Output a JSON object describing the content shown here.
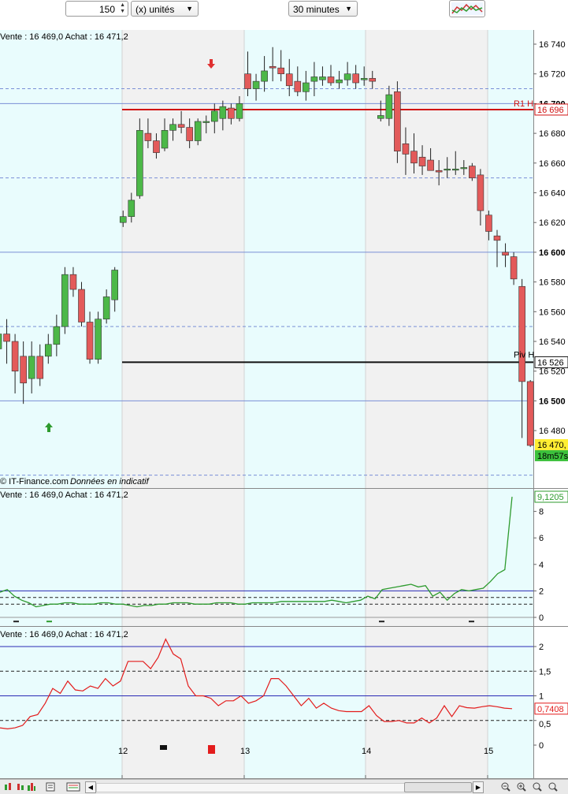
{
  "toolbar": {
    "quantity": "150",
    "unit_label": "(x) unités",
    "timeframe": "30 minutes"
  },
  "price_chart": {
    "header": "Vente : 16 469,0 Achat : 16 471,2",
    "watermark_source": "© IT-Finance.com",
    "watermark_note": "Données en indicatif",
    "y_ticks": [
      {
        "label": "16 740",
        "v": 16740,
        "bold": false
      },
      {
        "label": "16 720",
        "v": 16720,
        "bold": false
      },
      {
        "label": "16 700",
        "v": 16700,
        "bold": true
      },
      {
        "label": "16 680",
        "v": 16680,
        "bold": false
      },
      {
        "label": "16 660",
        "v": 16660,
        "bold": false
      },
      {
        "label": "16 640",
        "v": 16640,
        "bold": false
      },
      {
        "label": "16 620",
        "v": 16620,
        "bold": false
      },
      {
        "label": "16 600",
        "v": 16600,
        "bold": true
      },
      {
        "label": "16 580",
        "v": 16580,
        "bold": false
      },
      {
        "label": "16 560",
        "v": 16560,
        "bold": false
      },
      {
        "label": "16 540",
        "v": 16540,
        "bold": false
      },
      {
        "label": "16 520",
        "v": 16520,
        "bold": false
      },
      {
        "label": "16 500",
        "v": 16500,
        "bold": true
      },
      {
        "label": "16 480",
        "v": 16480,
        "bold": false
      }
    ],
    "r1_label": "R1 H",
    "r1_price": "16 696",
    "piv_label": "Piv H",
    "piv_price": "16 526",
    "last_price": "16 470,",
    "countdown": "18m57s",
    "x_labels": [
      "12",
      "13",
      "14",
      "15"
    ]
  },
  "indicator1": {
    "header": "Vente : 16 469,0 Achat : 16 471,2",
    "value": "9,1205",
    "ticks": [
      "8",
      "6",
      "4",
      "2",
      "0"
    ]
  },
  "indicator2": {
    "header": "Vente : 16 469,0 Achat : 16 471,2",
    "value": "0,7408",
    "ticks": [
      "2",
      "1,5",
      "1",
      "0,5",
      "0"
    ]
  },
  "chart_data": [
    {
      "type": "candlestick",
      "title": "",
      "timeframe": "30 minutes",
      "x_ticks": [
        "12",
        "13",
        "14",
        "15"
      ],
      "ylim": [
        16450,
        16755
      ],
      "levels": {
        "R1 H": 16696,
        "Piv H": 16526
      },
      "last": 16470,
      "candles": [
        {
          "o": 16535,
          "h": 16550,
          "l": 16515,
          "c": 16545
        },
        {
          "o": 16545,
          "h": 16555,
          "l": 16525,
          "c": 16540
        },
        {
          "o": 16540,
          "h": 16545,
          "l": 16505,
          "c": 16520
        },
        {
          "o": 16530,
          "h": 16540,
          "l": 16498,
          "c": 16512
        },
        {
          "o": 16515,
          "h": 16540,
          "l": 16505,
          "c": 16530
        },
        {
          "o": 16530,
          "h": 16538,
          "l": 16510,
          "c": 16515
        },
        {
          "o": 16530,
          "h": 16545,
          "l": 16525,
          "c": 16538
        },
        {
          "o": 16538,
          "h": 16558,
          "l": 16530,
          "c": 16550
        },
        {
          "o": 16550,
          "h": 16590,
          "l": 16545,
          "c": 16585
        },
        {
          "o": 16585,
          "h": 16590,
          "l": 16570,
          "c": 16575
        },
        {
          "o": 16575,
          "h": 16580,
          "l": 16550,
          "c": 16553
        },
        {
          "o": 16553,
          "h": 16560,
          "l": 16525,
          "c": 16528
        },
        {
          "o": 16528,
          "h": 16560,
          "l": 16525,
          "c": 16555
        },
        {
          "o": 16555,
          "h": 16575,
          "l": 16552,
          "c": 16570
        },
        {
          "o": 16568,
          "h": 16590,
          "l": 16560,
          "c": 16588
        },
        {
          "o": 16620,
          "h": 16628,
          "l": 16617,
          "c": 16624
        },
        {
          "o": 16624,
          "h": 16640,
          "l": 16620,
          "c": 16635
        },
        {
          "o": 16638,
          "h": 16690,
          "l": 16636,
          "c": 16682
        },
        {
          "o": 16680,
          "h": 16690,
          "l": 16670,
          "c": 16675
        },
        {
          "o": 16675,
          "h": 16680,
          "l": 16663,
          "c": 16667
        },
        {
          "o": 16670,
          "h": 16690,
          "l": 16668,
          "c": 16682
        },
        {
          "o": 16682,
          "h": 16690,
          "l": 16675,
          "c": 16686
        },
        {
          "o": 16686,
          "h": 16695,
          "l": 16680,
          "c": 16684
        },
        {
          "o": 16684,
          "h": 16690,
          "l": 16670,
          "c": 16675
        },
        {
          "o": 16675,
          "h": 16690,
          "l": 16672,
          "c": 16688
        },
        {
          "o": 16688,
          "h": 16692,
          "l": 16680,
          "c": 16688
        },
        {
          "o": 16688,
          "h": 16700,
          "l": 16680,
          "c": 16695
        },
        {
          "o": 16690,
          "h": 16702,
          "l": 16682,
          "c": 16698
        },
        {
          "o": 16697,
          "h": 16700,
          "l": 16686,
          "c": 16690
        },
        {
          "o": 16690,
          "h": 16705,
          "l": 16688,
          "c": 16700
        },
        {
          "o": 16720,
          "h": 16735,
          "l": 16705,
          "c": 16710
        },
        {
          "o": 16710,
          "h": 16720,
          "l": 16702,
          "c": 16715
        },
        {
          "o": 16715,
          "h": 16732,
          "l": 16708,
          "c": 16722
        },
        {
          "o": 16725,
          "h": 16738,
          "l": 16715,
          "c": 16724
        },
        {
          "o": 16724,
          "h": 16736,
          "l": 16715,
          "c": 16720
        },
        {
          "o": 16720,
          "h": 16730,
          "l": 16705,
          "c": 16712
        },
        {
          "o": 16715,
          "h": 16725,
          "l": 16705,
          "c": 16708
        },
        {
          "o": 16708,
          "h": 16722,
          "l": 16702,
          "c": 16714
        },
        {
          "o": 16715,
          "h": 16728,
          "l": 16705,
          "c": 16718
        },
        {
          "o": 16716,
          "h": 16725,
          "l": 16712,
          "c": 16718
        },
        {
          "o": 16718,
          "h": 16726,
          "l": 16712,
          "c": 16714
        },
        {
          "o": 16714,
          "h": 16722,
          "l": 16710,
          "c": 16716
        },
        {
          "o": 16716,
          "h": 16728,
          "l": 16712,
          "c": 16720
        },
        {
          "o": 16720,
          "h": 16726,
          "l": 16710,
          "c": 16714
        },
        {
          "o": 16716,
          "h": 16725,
          "l": 16712,
          "c": 16717
        },
        {
          "o": 16717,
          "h": 16722,
          "l": 16710,
          "c": 16715
        },
        {
          "o": 16690,
          "h": 16702,
          "l": 16688,
          "c": 16692
        },
        {
          "o": 16690,
          "h": 16712,
          "l": 16685,
          "c": 16706
        },
        {
          "o": 16708,
          "h": 16715,
          "l": 16660,
          "c": 16668
        },
        {
          "o": 16673,
          "h": 16684,
          "l": 16652,
          "c": 16666
        },
        {
          "o": 16668,
          "h": 16680,
          "l": 16653,
          "c": 16660
        },
        {
          "o": 16664,
          "h": 16672,
          "l": 16652,
          "c": 16658
        },
        {
          "o": 16662,
          "h": 16670,
          "l": 16655,
          "c": 16655
        },
        {
          "o": 16655,
          "h": 16662,
          "l": 16645,
          "c": 16654
        },
        {
          "o": 16656,
          "h": 16664,
          "l": 16650,
          "c": 16656
        },
        {
          "o": 16656,
          "h": 16668,
          "l": 16652,
          "c": 16656
        },
        {
          "o": 16657,
          "h": 16662,
          "l": 16652,
          "c": 16657
        },
        {
          "o": 16658,
          "h": 16660,
          "l": 16648,
          "c": 16650
        },
        {
          "o": 16652,
          "h": 16656,
          "l": 16618,
          "c": 16628
        },
        {
          "o": 16625,
          "h": 16628,
          "l": 16608,
          "c": 16614
        },
        {
          "o": 16611,
          "h": 16615,
          "l": 16590,
          "c": 16608
        },
        {
          "o": 16600,
          "h": 16606,
          "l": 16590,
          "c": 16598
        },
        {
          "o": 16597,
          "h": 16600,
          "l": 16578,
          "c": 16582
        },
        {
          "o": 16577,
          "h": 16582,
          "l": 16475,
          "c": 16513
        },
        {
          "o": 16513,
          "h": 16514,
          "l": 16469,
          "c": 16470
        }
      ]
    },
    {
      "type": "line",
      "title": "",
      "ylim": [
        -0.5,
        10
      ],
      "reference_lines": [
        2,
        1.5,
        1
      ],
      "series": [
        {
          "values": [
            1.9,
            2.1,
            1.6,
            1.3,
            1.1,
            0.8,
            0.9,
            1.0,
            1.0,
            1.1,
            1.1,
            1.0,
            1.0,
            1.0,
            1.1,
            1.1,
            1.0,
            1.0,
            0.9,
            0.8,
            0.9,
            0.9,
            1.0,
            1.0,
            1.1,
            1.1,
            1.1,
            1.0,
            1.0,
            1.0,
            1.1,
            1.1,
            1.1,
            1.0,
            1.0,
            1.1,
            1.1,
            1.1,
            1.1,
            1.2,
            1.2,
            1.2,
            1.2,
            1.2,
            1.2,
            1.2,
            1.3,
            1.2,
            1.1,
            1.2,
            1.3,
            1.6,
            1.4,
            2.1,
            2.2,
            2.3,
            2.4,
            2.5,
            2.3,
            2.4,
            1.6,
            1.9,
            1.3,
            1.8,
            2.1,
            2.0,
            2.1,
            2.2,
            2.7,
            3.3,
            3.6,
            9.1
          ]
        }
      ]
    },
    {
      "type": "line",
      "title": "",
      "ylim": [
        -0.2,
        2.4
      ],
      "reference_lines": [
        2,
        1.5,
        1,
        0.5
      ],
      "series": [
        {
          "values": [
            0.35,
            0.33,
            0.35,
            0.4,
            0.58,
            0.62,
            0.85,
            1.15,
            1.05,
            1.3,
            1.12,
            1.1,
            1.2,
            1.15,
            1.35,
            1.2,
            1.3,
            1.7,
            1.7,
            1.7,
            1.55,
            1.78,
            2.15,
            1.85,
            1.75,
            1.2,
            1.0,
            1.0,
            0.95,
            0.8,
            0.9,
            0.9,
            1.0,
            0.85,
            0.9,
            1.0,
            1.35,
            1.35,
            1.2,
            1.0,
            0.8,
            0.95,
            0.75,
            0.85,
            0.75,
            0.7,
            0.68,
            0.68,
            0.68,
            0.8,
            0.6,
            0.48,
            0.48,
            0.5,
            0.45,
            0.45,
            0.55,
            0.45,
            0.55,
            0.8,
            0.58,
            0.8,
            0.76,
            0.75,
            0.78,
            0.8,
            0.78,
            0.75,
            0.74
          ]
        }
      ]
    }
  ]
}
